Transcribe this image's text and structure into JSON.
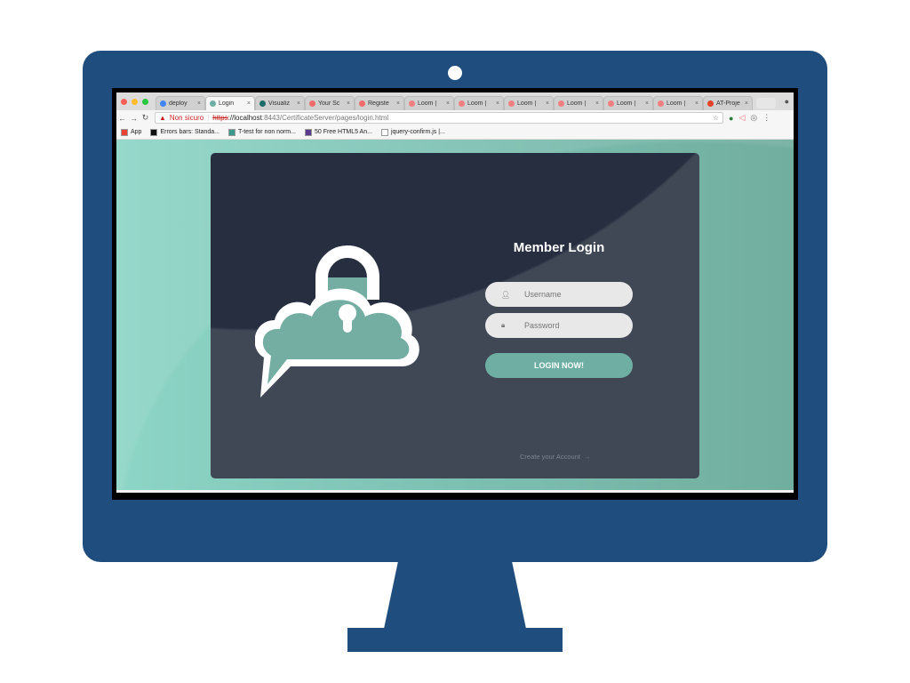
{
  "browser": {
    "tabs": [
      {
        "label": "deploy",
        "icon": "google-icon",
        "color": "#4285f4"
      },
      {
        "label": "Login",
        "icon": "mountain-icon",
        "color": "#6fafa3",
        "active": true
      },
      {
        "label": "Visualiz",
        "icon": "circle-icon",
        "color": "#1b6b6b"
      },
      {
        "label": "Your Sc",
        "icon": "loom-record-icon",
        "color": "#f26b6b"
      },
      {
        "label": "Registe",
        "icon": "loom-record-icon",
        "color": "#f26b6b"
      },
      {
        "label": "Loom |",
        "icon": "loom-icon",
        "color": "#f08080"
      },
      {
        "label": "Loom |",
        "icon": "loom-icon",
        "color": "#f08080"
      },
      {
        "label": "Loom |",
        "icon": "loom-icon",
        "color": "#f08080"
      },
      {
        "label": "Loom |",
        "icon": "loom-icon",
        "color": "#f08080"
      },
      {
        "label": "Loom |",
        "icon": "loom-icon",
        "color": "#f08080"
      },
      {
        "label": "Loom |",
        "icon": "loom-icon",
        "color": "#f08080"
      },
      {
        "label": "AT-Proje",
        "icon": "gitlab-icon",
        "color": "#e24329"
      }
    ],
    "security_warning": "Non sicuro",
    "url": {
      "scheme": "https",
      "host": "://localhost",
      "path": ":8443/CertificateServer/pages/login.html"
    },
    "bookmarks": [
      {
        "label": "App",
        "color": "#e94235"
      },
      {
        "label": "Errors bars: Standa...",
        "color": "#111"
      },
      {
        "label": "T-test for non norm...",
        "color": "#3a9b8c"
      },
      {
        "label": "50 Free HTML5 An...",
        "color": "#5b3b8c"
      },
      {
        "label": "jquery-confirm.js |...",
        "color": "#fff"
      }
    ]
  },
  "login": {
    "title": "Member Login",
    "username_placeholder": "Username",
    "password_placeholder": "Password",
    "button": "LOGIN NOW!",
    "create_account": "Create your Account",
    "arrow": "→"
  },
  "colors": {
    "monitor": "#1f4e7e",
    "card": "#404856",
    "accent": "#6fafa3"
  }
}
